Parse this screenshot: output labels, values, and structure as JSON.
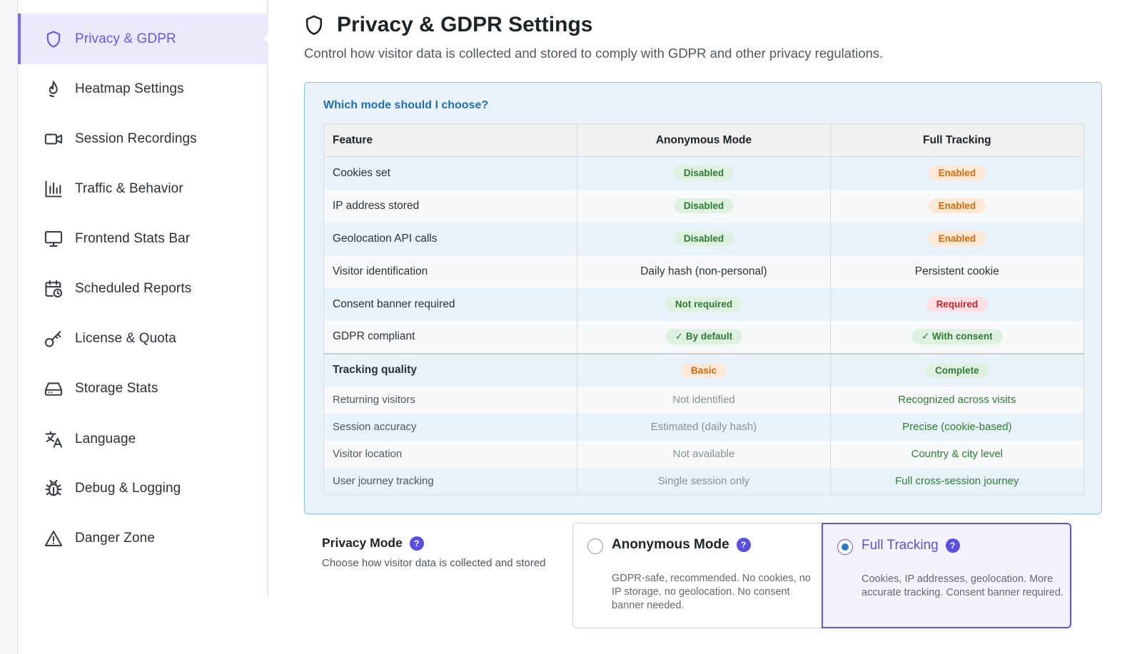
{
  "sidebar": {
    "items": [
      {
        "label": "Privacy & GDPR",
        "icon": "shield-icon",
        "active": true
      },
      {
        "label": "Heatmap Settings",
        "icon": "flame-icon"
      },
      {
        "label": "Session Recordings",
        "icon": "video-camera-icon"
      },
      {
        "label": "Traffic & Behavior",
        "icon": "bar-chart-icon"
      },
      {
        "label": "Frontend Stats Bar",
        "icon": "monitor-icon"
      },
      {
        "label": "Scheduled Reports",
        "icon": "calendar-clock-icon"
      },
      {
        "label": "License & Quota",
        "icon": "key-icon"
      },
      {
        "label": "Storage Stats",
        "icon": "hard-drive-icon"
      },
      {
        "label": "Language",
        "icon": "translate-icon"
      },
      {
        "label": "Debug & Logging",
        "icon": "bug-icon"
      },
      {
        "label": "Danger Zone",
        "icon": "warning-triangle-icon"
      }
    ]
  },
  "header": {
    "title": "Privacy & GDPR Settings",
    "description": "Control how visitor data is collected and stored to comply with GDPR and other privacy regulations."
  },
  "info_box": {
    "title": "Which mode should I choose?",
    "columns": [
      "Feature",
      "Anonymous Mode",
      "Full Tracking"
    ],
    "rows": [
      {
        "feature": "Cookies set",
        "anonymous": "Disabled",
        "full": "Enabled"
      },
      {
        "feature": "IP address stored",
        "anonymous": "Disabled",
        "full": "Enabled"
      },
      {
        "feature": "Geolocation API calls",
        "anonymous": "Disabled",
        "full": "Enabled"
      },
      {
        "feature": "Visitor identification",
        "anonymous": "Daily hash (non-personal)",
        "full": "Persistent cookie"
      },
      {
        "feature": "Consent banner required",
        "anonymous": "Not required",
        "full": "Required"
      },
      {
        "feature": "GDPR compliant",
        "anonymous": "✓ By default",
        "full": "✓ With consent"
      },
      {
        "feature": "Tracking quality",
        "anonymous": "Basic",
        "full": "Complete"
      },
      {
        "feature": "Returning visitors",
        "anonymous": "Not identified",
        "full": "Recognized across visits"
      },
      {
        "feature": "Session accuracy",
        "anonymous": "Estimated (daily hash)",
        "full": "Precise (cookie-based)"
      },
      {
        "feature": "Visitor location",
        "anonymous": "Not available",
        "full": "Country & city level"
      },
      {
        "feature": "User journey tracking",
        "anonymous": "Single session only",
        "full": "Full cross-session journey"
      }
    ]
  },
  "privacy_mode": {
    "label": "Privacy Mode",
    "help": "?",
    "description": "Choose how visitor data is collected and stored",
    "options": [
      {
        "title": "Anonymous Mode",
        "description": "GDPR-safe, recommended. No cookies, no IP storage, no geolocation. No consent banner needed.",
        "selected": false
      },
      {
        "title": "Full Tracking",
        "description": "Cookies, IP addresses, geolocation. More accurate tracking. Consent banner required.",
        "selected": true
      }
    ]
  },
  "colors": {
    "accent": "#6a57e6",
    "active_bg": "#ebe9fb",
    "info_bg": "#eaf3fb",
    "info_border": "#8cc2ea",
    "badge_green": "#2f7a34",
    "badge_orange": "#d46a10",
    "badge_red": "#c8232f"
  }
}
